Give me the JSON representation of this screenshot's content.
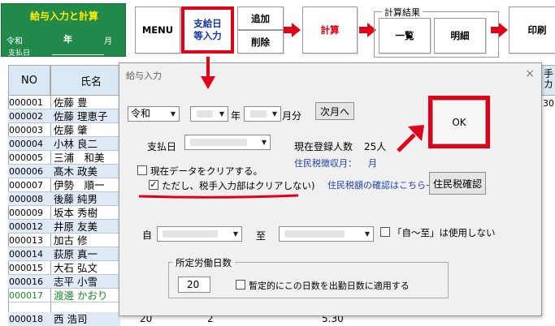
{
  "header": {
    "app_title": "給与入力と計算",
    "era": "令和",
    "year_suffix": "年",
    "month_suffix": "月",
    "payday_label": "支払日"
  },
  "toolbar": {
    "menu": "MENU",
    "payday_input": [
      "支給日",
      "等入力"
    ],
    "add": "追加",
    "delete": "削除",
    "calc": "計算",
    "result_group": "計算結果",
    "list": "一覧",
    "detail": "明細",
    "print": "印刷"
  },
  "table": {
    "columns": [
      "NO",
      "氏名"
    ],
    "right_col_fragments": [
      "手",
      "カ",
      "30"
    ],
    "rows": [
      {
        "no": "000001",
        "name": "佐藤 豊"
      },
      {
        "no": "000002",
        "name": "佐藤 理恵子"
      },
      {
        "no": "000003",
        "name": "佐藤 肇"
      },
      {
        "no": "000004",
        "name": "小林 良二"
      },
      {
        "no": "000005",
        "name": "三浦　和美"
      },
      {
        "no": "000006",
        "name": "髙木 政美"
      },
      {
        "no": "000007",
        "name": "伊勢　順一"
      },
      {
        "no": "000008",
        "name": "後藤 純男"
      },
      {
        "no": "000009",
        "name": "坂本 秀樹"
      },
      {
        "no": "000012",
        "name": "井原 友美"
      },
      {
        "no": "000013",
        "name": "加古 修"
      },
      {
        "no": "000014",
        "name": "荻原 真一"
      },
      {
        "no": "000015",
        "name": "大石 弘文"
      },
      {
        "no": "000016",
        "name": "志平 小雪"
      },
      {
        "no": "000017",
        "name": "渡邊 かおり"
      },
      {
        "no": "000018",
        "name": "西 浩司"
      }
    ],
    "last_row_extra": [
      "20",
      "2",
      "5.30"
    ]
  },
  "dialog": {
    "title": "給与入力",
    "close": "×",
    "era_value": "令和",
    "year_label": "年",
    "month_label": "月分",
    "next_month": "次月へ",
    "ok": "OK",
    "payday_label": "支払日",
    "registered_label": "現在登録人数",
    "registered_count": "25人",
    "resident_tax_month_label": "住民税徴収月：",
    "resident_tax_month_suffix": "月",
    "clear_data": "現在データをクリアする。",
    "keep_tax_input": "ただし、税手入力部はクリアしない)",
    "resident_tax_check_link": "住民税額の確認はこちら→",
    "resident_tax_check_btn": "住民税確認",
    "from_label": "自",
    "to_label": "至",
    "no_range": "「自～至」は使用しない",
    "workdays_group": "所定労働日数",
    "workdays_value": "20",
    "apply_workdays": "暫定的にこの日数を出勤日数に適用する"
  },
  "colors": {
    "app_panel": "#21894a",
    "accent_red": "#e00018",
    "link_blue": "#2040b8",
    "row_alt": "#dfeaf6",
    "header_bg": "#dae8f5"
  }
}
